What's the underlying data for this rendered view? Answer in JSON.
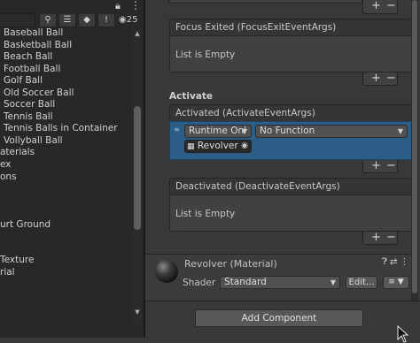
{
  "hierarchy": {
    "eye_count": "25",
    "items": [
      "Baseball Ball",
      "Basketball Ball",
      "Beach Ball",
      "Football Ball",
      "Golf Ball",
      "Old Soccer Ball",
      "Soccer Ball",
      "Tennis Ball",
      "Tennis Balls in Container",
      "Vollyball Ball"
    ],
    "lower_items": [
      "aterials",
      "ex",
      "ons",
      "",
      "",
      "",
      "urt Ground",
      "",
      "",
      "Texture",
      "rial"
    ]
  },
  "inspector": {
    "focus_exited": {
      "header": "Focus Exited (FocusExitEventArgs)",
      "empty": "List is Empty",
      "add": "+",
      "remove": "−"
    },
    "activate": {
      "section_label": "Activate",
      "header": "Activated (ActivateEventArgs)",
      "runtime_value": "Runtime Onl",
      "function_value": "No Function",
      "object_value": "Revolver",
      "add": "+",
      "remove": "−"
    },
    "deactivated": {
      "header": "Deactivated (DeactivateEventArgs)",
      "empty": "List is Empty",
      "add": "+",
      "remove": "−"
    },
    "top_controls": {
      "add": "+",
      "remove": "−"
    },
    "material": {
      "title": "Revolver (Material)",
      "shader_label": "Shader",
      "shader_value": "Standard",
      "edit_label": "Edit...",
      "list_icon": "≡"
    },
    "add_component_label": "Add Component"
  },
  "colors": {
    "selection": "#2c5d87",
    "panel": "#383838",
    "tree_bg": "#282828"
  }
}
